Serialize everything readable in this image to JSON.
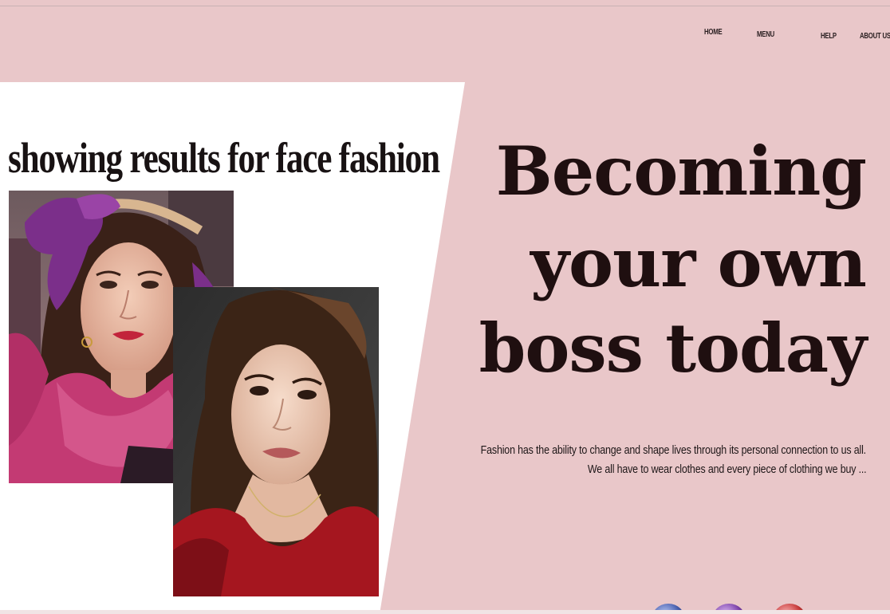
{
  "nav": {
    "home": "HOME",
    "menu": "MENU",
    "help": "HELP",
    "about": "ABOUT US"
  },
  "results": {
    "heading": "showing results for face fashion"
  },
  "hero": {
    "line1": "Becoming",
    "line2": "your own",
    "line3": "boss today",
    "description_line1": "Fashion has the ability to change and shape lives through its personal connection to us all.",
    "description_line2": "We all have to wear clothes and every piece of clothing we buy ..."
  },
  "carousel": {
    "dots": [
      "blue",
      "purple",
      "red"
    ]
  },
  "colors": {
    "background": "#e9c7c9",
    "panel": "#ffffff",
    "headline": "#1f0f10"
  }
}
